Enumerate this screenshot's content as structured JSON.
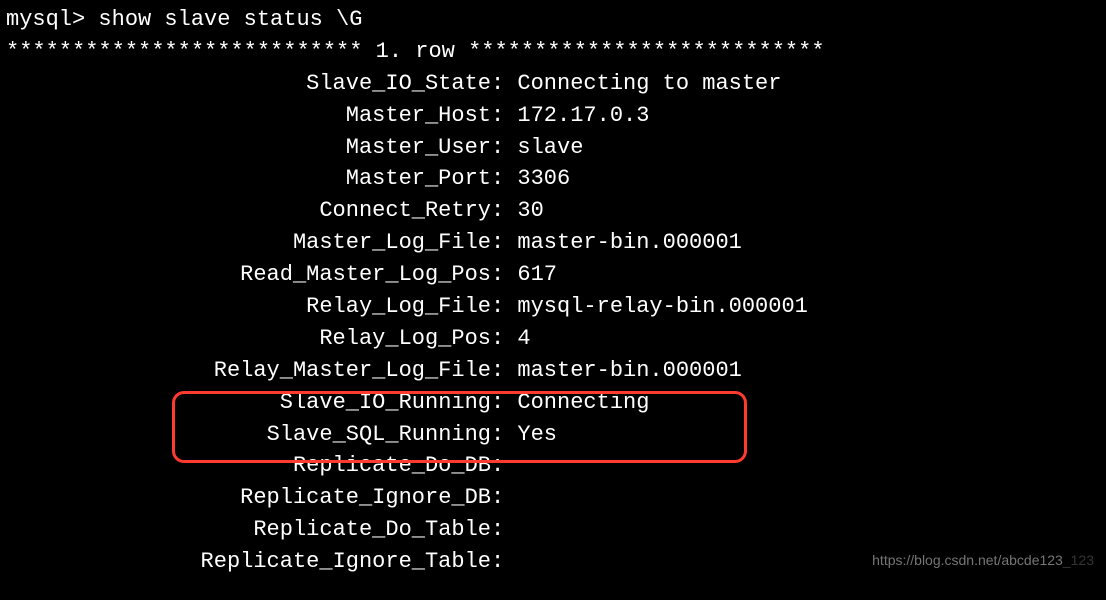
{
  "prompt": "mysql>",
  "command": "show slave status \\G",
  "row_header": "*************************** 1. row ***************************",
  "fields": [
    {
      "key": "Slave_IO_State",
      "val": "Connecting to master"
    },
    {
      "key": "Master_Host",
      "val": "172.17.0.3"
    },
    {
      "key": "Master_User",
      "val": "slave"
    },
    {
      "key": "Master_Port",
      "val": "3306"
    },
    {
      "key": "Connect_Retry",
      "val": "30"
    },
    {
      "key": "Master_Log_File",
      "val": "master-bin.000001"
    },
    {
      "key": "Read_Master_Log_Pos",
      "val": "617"
    },
    {
      "key": "Relay_Log_File",
      "val": "mysql-relay-bin.000001"
    },
    {
      "key": "Relay_Log_Pos",
      "val": "4"
    },
    {
      "key": "Relay_Master_Log_File",
      "val": "master-bin.000001"
    },
    {
      "key": "Slave_IO_Running",
      "val": "Connecting",
      "highlighted": true
    },
    {
      "key": "Slave_SQL_Running",
      "val": "Yes",
      "highlighted": true
    },
    {
      "key": "Replicate_Do_DB",
      "val": ""
    },
    {
      "key": "Replicate_Ignore_DB",
      "val": ""
    },
    {
      "key": "Replicate_Do_Table",
      "val": ""
    },
    {
      "key": "Replicate_Ignore_Table",
      "val": ""
    }
  ],
  "watermark": {
    "main": "https://blog.csdn.net/abcde123",
    "faint": "_123"
  }
}
